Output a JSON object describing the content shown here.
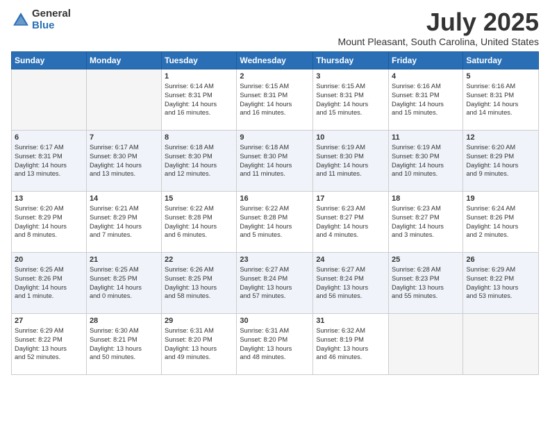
{
  "logo": {
    "general": "General",
    "blue": "Blue"
  },
  "header": {
    "month": "July 2025",
    "location": "Mount Pleasant, South Carolina, United States"
  },
  "weekdays": [
    "Sunday",
    "Monday",
    "Tuesday",
    "Wednesday",
    "Thursday",
    "Friday",
    "Saturday"
  ],
  "weeks": [
    [
      {
        "day": "",
        "info": ""
      },
      {
        "day": "",
        "info": ""
      },
      {
        "day": "1",
        "info": "Sunrise: 6:14 AM\nSunset: 8:31 PM\nDaylight: 14 hours\nand 16 minutes."
      },
      {
        "day": "2",
        "info": "Sunrise: 6:15 AM\nSunset: 8:31 PM\nDaylight: 14 hours\nand 16 minutes."
      },
      {
        "day": "3",
        "info": "Sunrise: 6:15 AM\nSunset: 8:31 PM\nDaylight: 14 hours\nand 15 minutes."
      },
      {
        "day": "4",
        "info": "Sunrise: 6:16 AM\nSunset: 8:31 PM\nDaylight: 14 hours\nand 15 minutes."
      },
      {
        "day": "5",
        "info": "Sunrise: 6:16 AM\nSunset: 8:31 PM\nDaylight: 14 hours\nand 14 minutes."
      }
    ],
    [
      {
        "day": "6",
        "info": "Sunrise: 6:17 AM\nSunset: 8:31 PM\nDaylight: 14 hours\nand 13 minutes."
      },
      {
        "day": "7",
        "info": "Sunrise: 6:17 AM\nSunset: 8:30 PM\nDaylight: 14 hours\nand 13 minutes."
      },
      {
        "day": "8",
        "info": "Sunrise: 6:18 AM\nSunset: 8:30 PM\nDaylight: 14 hours\nand 12 minutes."
      },
      {
        "day": "9",
        "info": "Sunrise: 6:18 AM\nSunset: 8:30 PM\nDaylight: 14 hours\nand 11 minutes."
      },
      {
        "day": "10",
        "info": "Sunrise: 6:19 AM\nSunset: 8:30 PM\nDaylight: 14 hours\nand 11 minutes."
      },
      {
        "day": "11",
        "info": "Sunrise: 6:19 AM\nSunset: 8:30 PM\nDaylight: 14 hours\nand 10 minutes."
      },
      {
        "day": "12",
        "info": "Sunrise: 6:20 AM\nSunset: 8:29 PM\nDaylight: 14 hours\nand 9 minutes."
      }
    ],
    [
      {
        "day": "13",
        "info": "Sunrise: 6:20 AM\nSunset: 8:29 PM\nDaylight: 14 hours\nand 8 minutes."
      },
      {
        "day": "14",
        "info": "Sunrise: 6:21 AM\nSunset: 8:29 PM\nDaylight: 14 hours\nand 7 minutes."
      },
      {
        "day": "15",
        "info": "Sunrise: 6:22 AM\nSunset: 8:28 PM\nDaylight: 14 hours\nand 6 minutes."
      },
      {
        "day": "16",
        "info": "Sunrise: 6:22 AM\nSunset: 8:28 PM\nDaylight: 14 hours\nand 5 minutes."
      },
      {
        "day": "17",
        "info": "Sunrise: 6:23 AM\nSunset: 8:27 PM\nDaylight: 14 hours\nand 4 minutes."
      },
      {
        "day": "18",
        "info": "Sunrise: 6:23 AM\nSunset: 8:27 PM\nDaylight: 14 hours\nand 3 minutes."
      },
      {
        "day": "19",
        "info": "Sunrise: 6:24 AM\nSunset: 8:26 PM\nDaylight: 14 hours\nand 2 minutes."
      }
    ],
    [
      {
        "day": "20",
        "info": "Sunrise: 6:25 AM\nSunset: 8:26 PM\nDaylight: 14 hours\nand 1 minute."
      },
      {
        "day": "21",
        "info": "Sunrise: 6:25 AM\nSunset: 8:25 PM\nDaylight: 14 hours\nand 0 minutes."
      },
      {
        "day": "22",
        "info": "Sunrise: 6:26 AM\nSunset: 8:25 PM\nDaylight: 13 hours\nand 58 minutes."
      },
      {
        "day": "23",
        "info": "Sunrise: 6:27 AM\nSunset: 8:24 PM\nDaylight: 13 hours\nand 57 minutes."
      },
      {
        "day": "24",
        "info": "Sunrise: 6:27 AM\nSunset: 8:24 PM\nDaylight: 13 hours\nand 56 minutes."
      },
      {
        "day": "25",
        "info": "Sunrise: 6:28 AM\nSunset: 8:23 PM\nDaylight: 13 hours\nand 55 minutes."
      },
      {
        "day": "26",
        "info": "Sunrise: 6:29 AM\nSunset: 8:22 PM\nDaylight: 13 hours\nand 53 minutes."
      }
    ],
    [
      {
        "day": "27",
        "info": "Sunrise: 6:29 AM\nSunset: 8:22 PM\nDaylight: 13 hours\nand 52 minutes."
      },
      {
        "day": "28",
        "info": "Sunrise: 6:30 AM\nSunset: 8:21 PM\nDaylight: 13 hours\nand 50 minutes."
      },
      {
        "day": "29",
        "info": "Sunrise: 6:31 AM\nSunset: 8:20 PM\nDaylight: 13 hours\nand 49 minutes."
      },
      {
        "day": "30",
        "info": "Sunrise: 6:31 AM\nSunset: 8:20 PM\nDaylight: 13 hours\nand 48 minutes."
      },
      {
        "day": "31",
        "info": "Sunrise: 6:32 AM\nSunset: 8:19 PM\nDaylight: 13 hours\nand 46 minutes."
      },
      {
        "day": "",
        "info": ""
      },
      {
        "day": "",
        "info": ""
      }
    ]
  ]
}
